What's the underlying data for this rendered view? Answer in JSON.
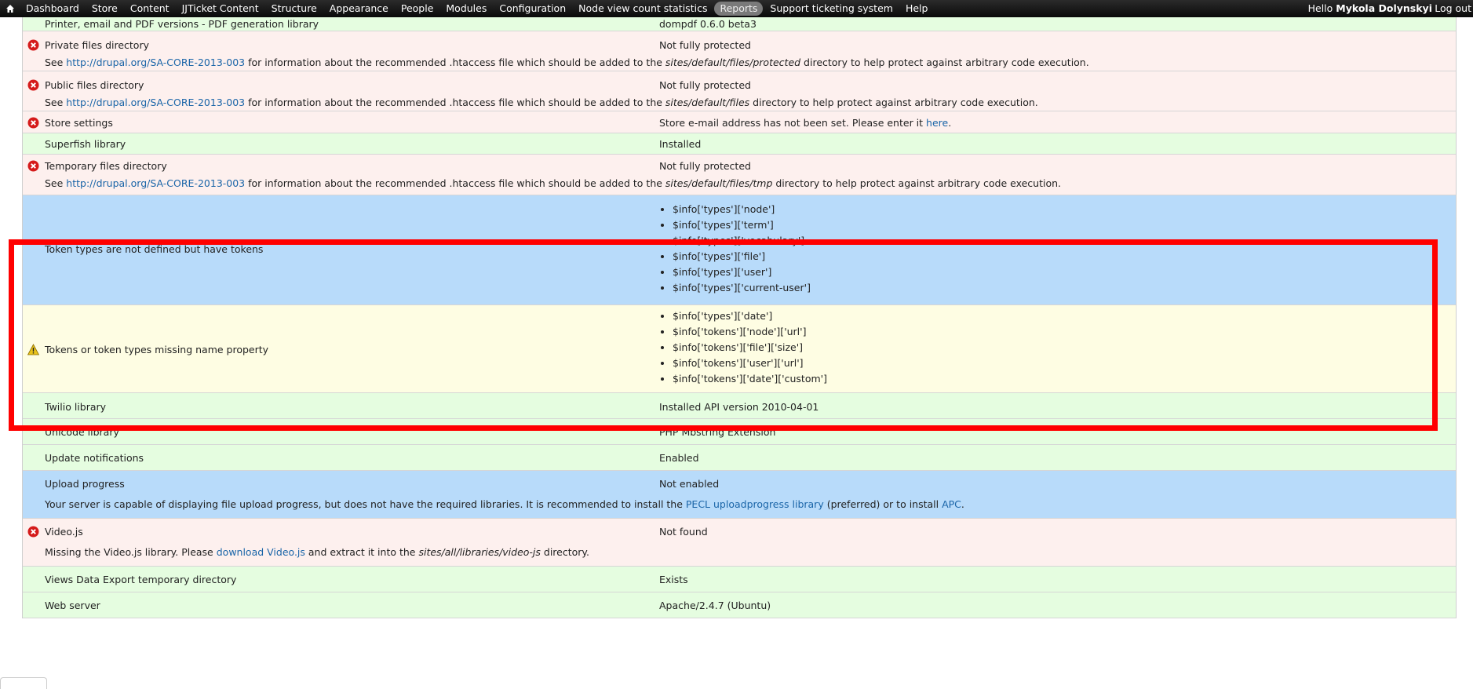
{
  "toolbar": {
    "items": [
      "Dashboard",
      "Store",
      "Content",
      "JJTicket Content",
      "Structure",
      "Appearance",
      "People",
      "Modules",
      "Configuration",
      "Node view count statistics",
      "Reports",
      "Support ticketing system",
      "Help"
    ],
    "active": "Reports",
    "greeting": "Hello ",
    "username": "Mykola Dolynskyi",
    "logout": "Log out"
  },
  "rows": {
    "printer": {
      "title": "Printer, email and PDF versions - PDF generation library",
      "value": "dompdf 0.6.0 beta3"
    },
    "private": {
      "title": "Private files directory",
      "value": "Not fully protected",
      "desc_pre": "See ",
      "link": "http://drupal.org/SA-CORE-2013-003",
      "desc_mid": " for information about the recommended .htaccess file which should be added to the ",
      "path": "sites/default/files/protected",
      "desc_post": " directory to help protect against arbitrary code execution."
    },
    "public": {
      "title": "Public files directory",
      "value": "Not fully protected",
      "desc_pre": "See ",
      "link": "http://drupal.org/SA-CORE-2013-003",
      "desc_mid": " for information about the recommended .htaccess file which should be added to the ",
      "path": "sites/default/files",
      "desc_post": " directory to help protect against arbitrary code execution."
    },
    "store": {
      "title": "Store settings",
      "value_pre": "Store e-mail address has not been set. Please enter it ",
      "value_link": "here",
      "value_post": "."
    },
    "superfish": {
      "title": "Superfish library",
      "value": "Installed"
    },
    "temporary": {
      "title": "Temporary files directory",
      "value": "Not fully protected",
      "desc_pre": "See ",
      "link": "http://drupal.org/SA-CORE-2013-003",
      "desc_mid": " for information about the recommended .htaccess file which should be added to the ",
      "path": "sites/default/files/tmp",
      "desc_post": " directory to help protect against arbitrary code execution."
    },
    "token_types": {
      "title": "Token types are not defined but have tokens",
      "values": [
        "$info['types']['node']",
        "$info['types']['term']",
        "$info['types']['vocabulary']",
        "$info['types']['file']",
        "$info['types']['user']",
        "$info['types']['current-user']"
      ]
    },
    "token_names": {
      "title": "Tokens or token types missing name property",
      "values": [
        "$info['types']['date']",
        "$info['tokens']['node']['url']",
        "$info['tokens']['file']['size']",
        "$info['tokens']['user']['url']",
        "$info['tokens']['date']['custom']"
      ]
    },
    "twilio": {
      "title": "Twilio library",
      "value": "Installed API version 2010-04-01"
    },
    "unicode": {
      "title": "Unicode library",
      "value": "PHP Mbstring Extension"
    },
    "update": {
      "title": "Update notifications",
      "value": "Enabled"
    },
    "upload": {
      "title": "Upload progress",
      "value": "Not enabled",
      "desc_pre": "Your server is capable of displaying file upload progress, but does not have the required libraries. It is recommended to install the ",
      "link1": "PECL uploadprogress library",
      "desc_mid": " (preferred) or to install ",
      "link2": "APC",
      "desc_post": "."
    },
    "videojs": {
      "title": "Video.js",
      "value": "Not found",
      "desc_pre": "Missing the Video.js library. Please ",
      "link": "download Video.js",
      "desc_mid": " and extract it into the ",
      "path": "sites/all/libraries/video-js",
      "desc_post": " directory."
    },
    "views_export": {
      "title": "Views Data Export temporary directory",
      "value": "Exists"
    },
    "webserver": {
      "title": "Web server",
      "value": "Apache/2.4.7 (Ubuntu)"
    }
  },
  "colors": {
    "ok": "#e5fde0",
    "error": "#fdf0ee",
    "info": "#b8dbfa",
    "warning": "#fefde3",
    "highlight": "#ff0000",
    "link": "#1a65a8"
  },
  "icons": {
    "error": "error-x-icon",
    "warning": "warning-triangle-icon",
    "home": "home-icon"
  }
}
